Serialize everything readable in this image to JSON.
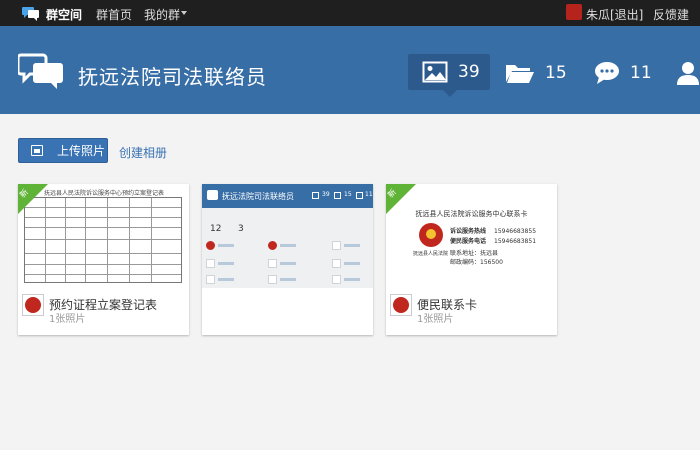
{
  "topbar": {
    "brand": "群空间",
    "nav_home": "群首页",
    "nav_mine": "我的群",
    "user": "朱瓜",
    "logout": "[退出]",
    "feedback": "反馈建议"
  },
  "header": {
    "group_name": "抚远法院司法联络员",
    "stats": {
      "photos": "39",
      "folders": "15",
      "comments": "11"
    }
  },
  "toolbar": {
    "upload_label": "上传照片",
    "create_album_label": "创建相册"
  },
  "albums": [
    {
      "title": "预约证程立案登记表",
      "count": "1张照片",
      "badge": "新",
      "cover": {
        "doc_title": "抚远县人民法院诉讼服务中心预约立案登记表"
      }
    },
    {
      "title": "",
      "count": "",
      "badge": "",
      "cover": {
        "app_title": "抚远法院司法联络员",
        "n1": "39",
        "n2": "15",
        "n3": "11",
        "stat1": "12",
        "stat2": "3"
      }
    },
    {
      "title": "便民联系卡",
      "count": "1张照片",
      "badge": "新",
      "cover": {
        "card_title": "抚远县人民法院诉讼服务中心联系卡",
        "court": "抚远县人民法院",
        "line1_label": "诉讼服务热线",
        "line1_value": "15946683855",
        "line2_label": "便民服务电话",
        "line2_value": "15946683851",
        "line3": "联系地址：抚远县",
        "line4": "邮政编码：156500"
      }
    }
  ],
  "colors": {
    "topbar": "#1f1f1f",
    "header": "#386ea6",
    "accent": "#3a73b3",
    "badge": "#5fb336",
    "background": "#f3f3f3"
  }
}
